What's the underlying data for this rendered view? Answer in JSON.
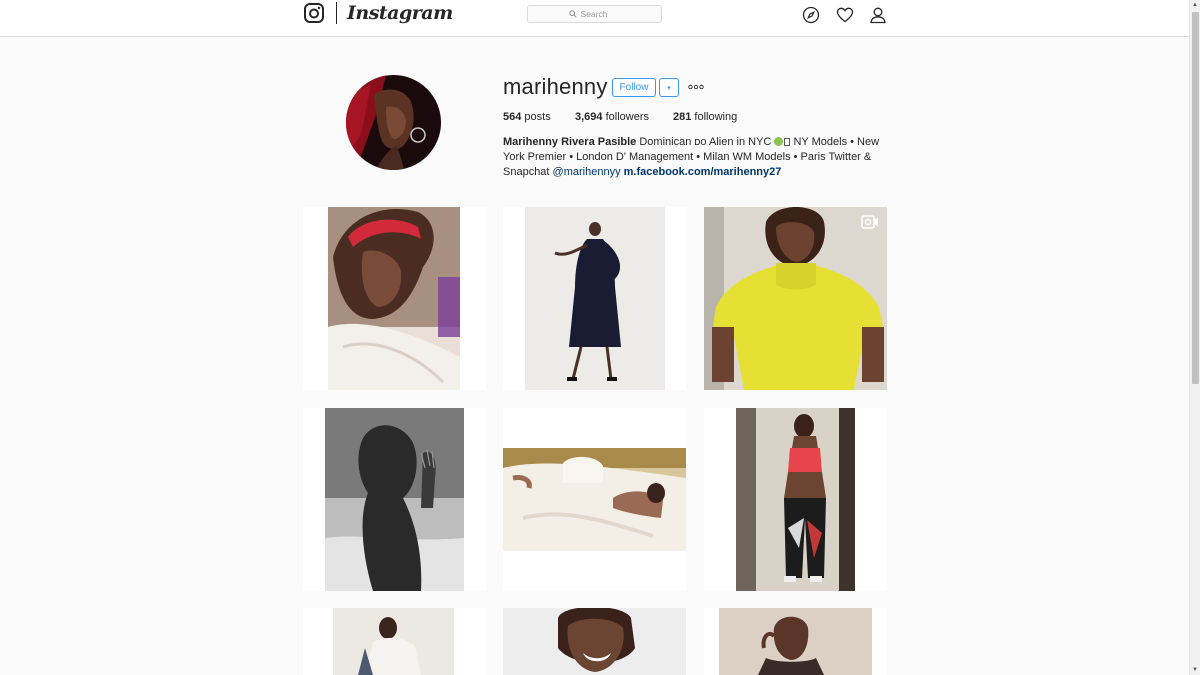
{
  "nav": {
    "logo_text": "Instagram",
    "search_placeholder": "Search"
  },
  "profile": {
    "username": "marihenny",
    "follow_label": "Follow",
    "dropdown_glyph": "▾",
    "stats": {
      "posts_count": "564",
      "posts_label": "posts",
      "followers_count": "3,694",
      "followers_label": "followers",
      "following_count": "281",
      "following_label": "following"
    },
    "bio": {
      "full_name": "Marihenny Rivera Pasible",
      "line1_a": "Dominican ᴅᴏ Alien in NYC",
      "line1_b": "NY Models • New York Premier • London D' Management • Milan WM Models • Paris Twitter & Snapchat",
      "handle": "@marihennyy",
      "link": "m.facebook.com/marihenny27"
    }
  },
  "grid": {
    "tiles": [
      {
        "name": "post-headscarf-selfie"
      },
      {
        "name": "post-dark-dress-studio"
      },
      {
        "name": "post-yellow-sweater",
        "video": true
      },
      {
        "name": "post-beach-bw"
      },
      {
        "name": "post-bed-lounging"
      },
      {
        "name": "post-mirror-selfie"
      },
      {
        "name": "post-white-sweater",
        "video": true
      },
      {
        "name": "post-laughing-portrait"
      },
      {
        "name": "post-portrait-pink"
      }
    ]
  },
  "icons": {
    "logo": "instagram-glyph-icon",
    "search": "search-icon",
    "explore": "compass-icon",
    "activity": "heart-icon",
    "profile": "user-icon",
    "more": "ellipsis-icon",
    "video": "video-icon"
  },
  "colors": {
    "accent": "#3897f0",
    "link": "#003569",
    "border": "#dbdbdb",
    "background": "#fafafa"
  }
}
